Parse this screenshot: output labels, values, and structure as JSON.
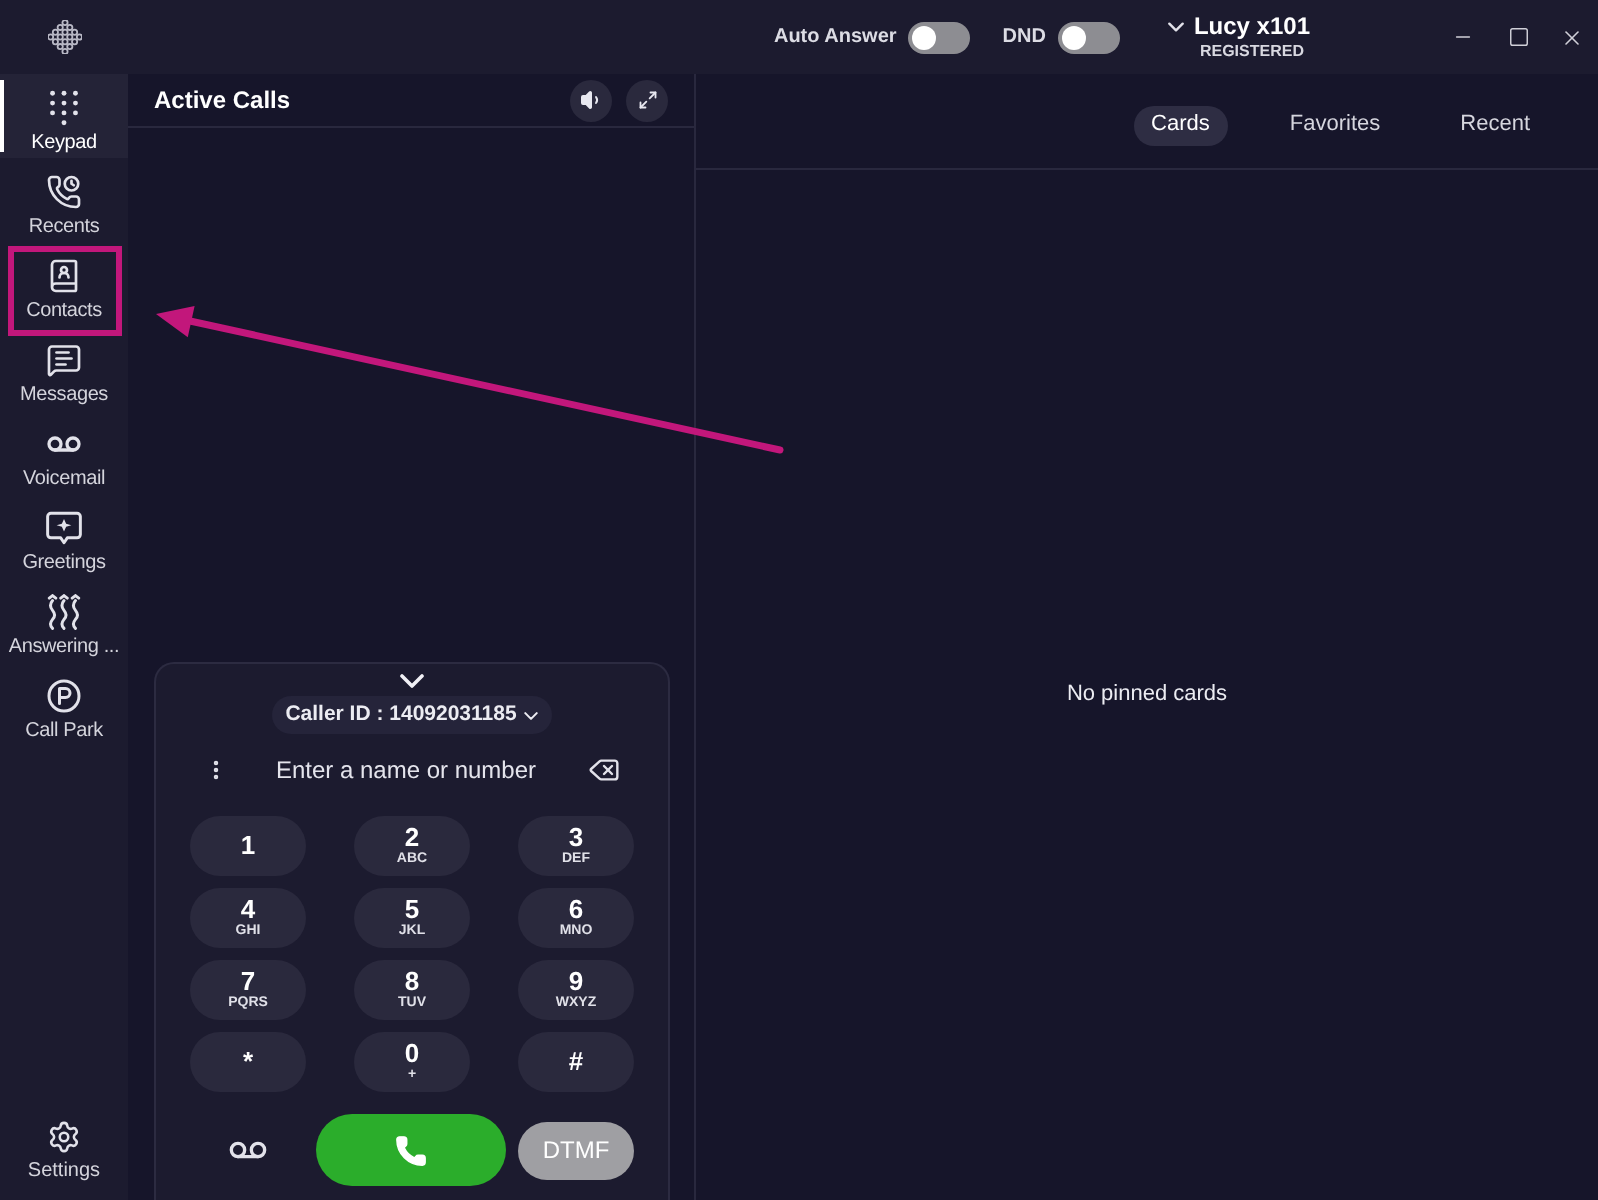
{
  "title_bar": {
    "toggles": [
      {
        "label": "Auto Answer",
        "on": false
      },
      {
        "label": "DND",
        "on": false
      }
    ],
    "user": {
      "name": "Lucy x101",
      "status": "REGISTERED"
    }
  },
  "sidebar": {
    "items": [
      {
        "label": "Keypad",
        "selected": true,
        "highlighted": false
      },
      {
        "label": "Recents",
        "selected": false,
        "highlighted": false
      },
      {
        "label": "Contacts",
        "selected": false,
        "highlighted": true
      },
      {
        "label": "Messages",
        "selected": false,
        "highlighted": false
      },
      {
        "label": "Voicemail",
        "selected": false,
        "highlighted": false
      },
      {
        "label": "Greetings",
        "selected": false,
        "highlighted": false
      },
      {
        "label": "Answering ...",
        "selected": false,
        "highlighted": false
      },
      {
        "label": "Call Park",
        "selected": false,
        "highlighted": false
      }
    ],
    "footer": {
      "label": "Settings"
    }
  },
  "active_calls": {
    "title": "Active Calls"
  },
  "dialer": {
    "caller_id": "Caller ID : 14092031185",
    "input": {
      "placeholder": "Enter a name or number"
    },
    "keys": [
      {
        "digit": "1"
      },
      {
        "digit": "2",
        "letters": "ABC"
      },
      {
        "digit": "3",
        "letters": "DEF"
      },
      {
        "digit": "4",
        "letters": "GHI"
      },
      {
        "digit": "5",
        "letters": "JKL"
      },
      {
        "digit": "6",
        "letters": "MNO"
      },
      {
        "digit": "7",
        "letters": "PQRS"
      },
      {
        "digit": "8",
        "letters": "TUV"
      },
      {
        "digit": "9",
        "letters": "WXYZ"
      },
      {
        "digit": "*"
      },
      {
        "digit": "0",
        "letters": "+"
      },
      {
        "digit": "#"
      }
    ],
    "dtmf": {
      "label": "DTMF",
      "disabled": true
    }
  },
  "pinned_panel": {
    "tabs": [
      {
        "label": "Cards",
        "selected": true
      },
      {
        "label": "Favorites",
        "selected": false
      },
      {
        "label": "Recent",
        "selected": false
      }
    ],
    "empty_message": "No pinned cards"
  }
}
